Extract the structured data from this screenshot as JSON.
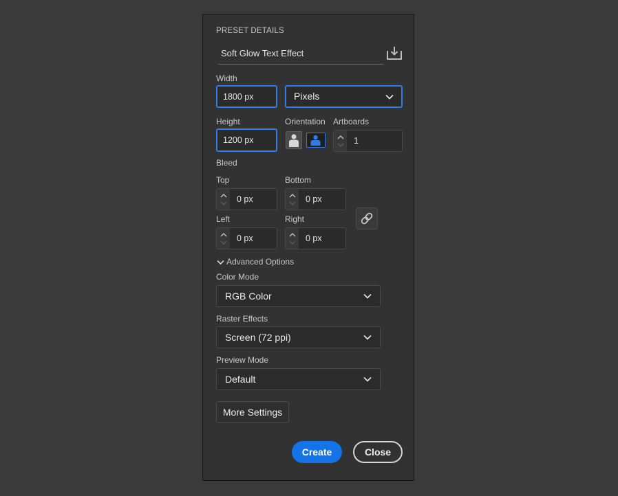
{
  "preset": {
    "section_title": "PRESET DETAILS",
    "name": "Soft Glow Text Effect",
    "save_icon": "save-preset-icon"
  },
  "size": {
    "width_label": "Width",
    "width_value": "1800 px",
    "units_value": "Pixels",
    "height_label": "Height",
    "height_value": "1200 px",
    "orientation_label": "Orientation",
    "orientation_selected": "landscape",
    "artboards_label": "Artboards",
    "artboards_value": "1"
  },
  "bleed": {
    "label": "Bleed",
    "top_label": "Top",
    "top_value": "0 px",
    "bottom_label": "Bottom",
    "bottom_value": "0 px",
    "left_label": "Left",
    "left_value": "0 px",
    "right_label": "Right",
    "right_value": "0 px",
    "link_icon": "link-icon"
  },
  "advanced": {
    "toggle_label": "Advanced Options",
    "color_mode_label": "Color Mode",
    "color_mode_value": "RGB Color",
    "raster_label": "Raster Effects",
    "raster_value": "Screen (72 ppi)",
    "preview_label": "Preview Mode",
    "preview_value": "Default"
  },
  "buttons": {
    "more_settings": "More Settings",
    "create": "Create",
    "close": "Close"
  },
  "colors": {
    "accent": "#1473e6",
    "focus": "#2f7ee8",
    "panel": "#323232",
    "background": "#3a3a3a"
  }
}
